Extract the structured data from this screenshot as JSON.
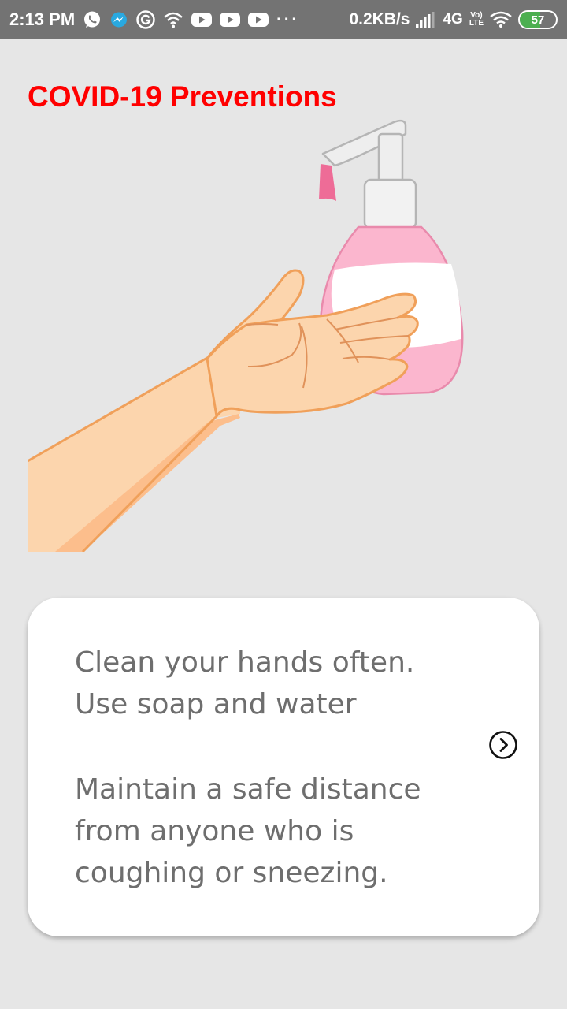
{
  "status_bar": {
    "time": "2:13 PM",
    "dots": "···",
    "net_speed": "0.2KB/s",
    "net_type": "4G",
    "volte_top": "Vo)",
    "volte_bottom": "LTE",
    "battery_level": "57",
    "battery_fraction": 0.57,
    "icons": [
      "whatsapp-icon",
      "messenger-icon",
      "google-icon",
      "wifi-hotspot-icon",
      "youtube-icon",
      "youtube-icon",
      "youtube-icon",
      "signal-icon",
      "wifi-icon",
      "battery-icon"
    ]
  },
  "title": "COVID-19 Preventions",
  "card": {
    "paragraph_1": "Clean your hands often.\nUse soap and water",
    "paragraph_2": "Maintain a safe distance\nfrom anyone who is\ncoughing or sneezing.",
    "next_icon": "chevron-right-circle-icon"
  },
  "colors": {
    "title": "#ff0000",
    "background": "#e6e6e6",
    "status_bar": "#737373",
    "card_text": "#6e6e6e",
    "skin": "#fcd5ad",
    "skin_outline": "#f0a05a",
    "soap_pink": "#fbb6ce"
  }
}
